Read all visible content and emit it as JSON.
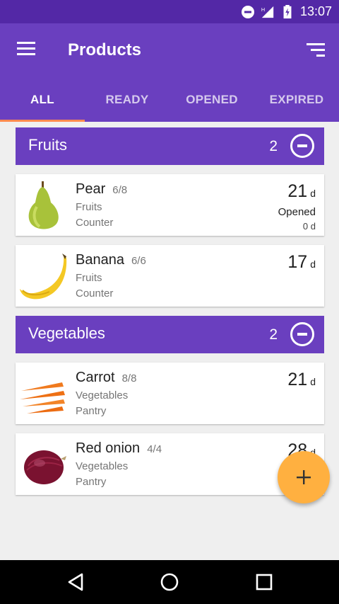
{
  "status_bar": {
    "time": "13:07",
    "icons": [
      "do-not-disturb-icon",
      "signal-icon",
      "battery-charging-icon"
    ]
  },
  "app_bar": {
    "title": "Products",
    "menu_icon": "menu-icon",
    "sort_icon": "sort-icon"
  },
  "tabs": [
    {
      "label": "ALL",
      "active": true
    },
    {
      "label": "READY",
      "active": false
    },
    {
      "label": "OPENED",
      "active": false
    },
    {
      "label": "EXPIRED",
      "active": false
    }
  ],
  "groups": [
    {
      "title": "Fruits",
      "count": "2",
      "items": [
        {
          "name": "Pear",
          "qty": "6/8",
          "category": "Fruits",
          "location": "Counter",
          "days": "21",
          "unit": "d",
          "status": "Opened",
          "status_days": "0 d",
          "icon": "pear-image"
        },
        {
          "name": "Banana",
          "qty": "6/6",
          "category": "Fruits",
          "location": "Counter",
          "days": "17",
          "unit": "d",
          "icon": "banana-image"
        }
      ]
    },
    {
      "title": "Vegetables",
      "count": "2",
      "items": [
        {
          "name": "Carrot",
          "qty": "8/8",
          "category": "Vegetables",
          "location": "Pantry",
          "days": "21",
          "unit": "d",
          "icon": "carrot-image"
        },
        {
          "name": "Red onion",
          "qty": "4/4",
          "category": "Vegetables",
          "location": "Pantry",
          "days": "28",
          "unit": "d",
          "icon": "red-onion-image"
        }
      ]
    }
  ],
  "fab": {
    "icon": "plus-icon"
  },
  "nav_bar": {
    "icons": [
      "back-icon",
      "home-icon",
      "recents-icon"
    ]
  },
  "colors": {
    "primary": "#6a3fbf",
    "primary_dark": "#5328a6",
    "accent": "#ffb040",
    "tab_indicator": "#ff8a50"
  }
}
